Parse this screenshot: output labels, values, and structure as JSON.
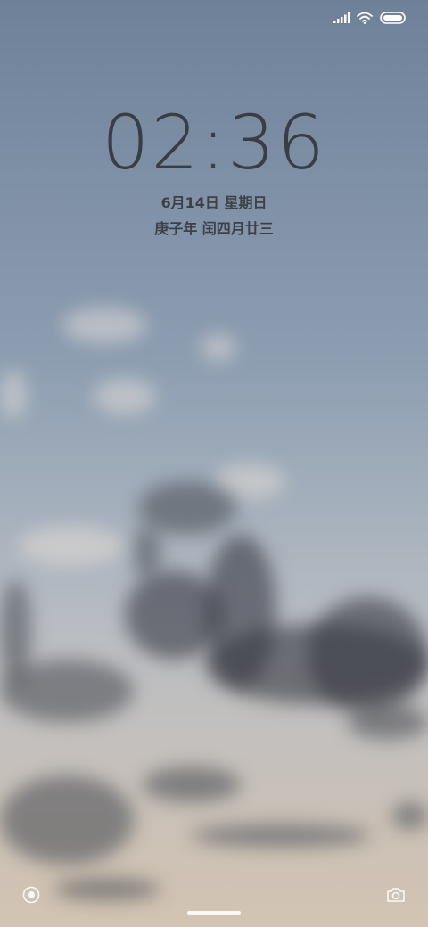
{
  "status_bar": {
    "signal_icon": "signal-icon",
    "wifi_icon": "wifi-icon",
    "battery_icon": "battery-icon"
  },
  "lock_screen": {
    "time": "02:36",
    "date": "6月14日 星期日",
    "lunar_date": "庚子年 闰四月廿三"
  },
  "bottom_controls": {
    "left_icon": "circle-icon",
    "right_icon": "camera-icon"
  }
}
